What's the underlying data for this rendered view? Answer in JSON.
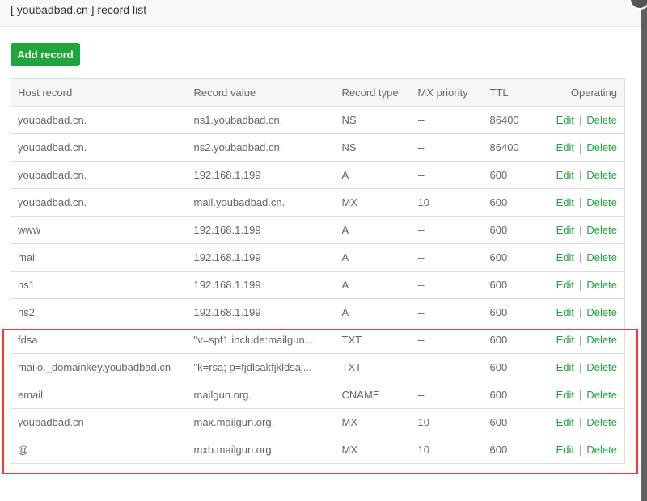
{
  "title": "[ youbadbad.cn ] record list",
  "add_label": "Add record",
  "columns": [
    "Host record",
    "Record value",
    "Record type",
    "MX priority",
    "TTL",
    "Operating"
  ],
  "edit_label": "Edit",
  "delete_label": "Delete",
  "sep": "|",
  "rows": [
    [
      "youbadbad.cn.",
      "ns1.youbadbad.cn.",
      "NS",
      "--",
      "86400"
    ],
    [
      "youbadbad.cn.",
      "ns2.youbadbad.cn.",
      "NS",
      "--",
      "86400"
    ],
    [
      "youbadbad.cn.",
      "192.168.1.199",
      "A",
      "--",
      "600"
    ],
    [
      "youbadbad.cn.",
      "mail.youbadbad.cn.",
      "MX",
      "10",
      "600"
    ],
    [
      "www",
      "192.168.1.199",
      "A",
      "--",
      "600"
    ],
    [
      "mail",
      "192.168.1.199",
      "A",
      "--",
      "600"
    ],
    [
      "ns1",
      "192.168.1.199",
      "A",
      "--",
      "600"
    ],
    [
      "ns2",
      "192.168.1.199",
      "A",
      "--",
      "600"
    ],
    [
      "fdsa",
      "\"v=spf1 include:mailgun...",
      "TXT",
      "--",
      "600"
    ],
    [
      "mailo._domainkey.youbadbad.cn",
      "\"k=rsa; p=fjdlsakfjkldsaj...",
      "TXT",
      "--",
      "600"
    ],
    [
      "email",
      "mailgun.org.",
      "CNAME",
      "--",
      "600"
    ],
    [
      "youbadbad.cn",
      "max.mailgun.org.",
      "MX",
      "10",
      "600"
    ],
    [
      "@",
      "mxb.mailgun.org.",
      "MX",
      "10",
      "600"
    ]
  ]
}
